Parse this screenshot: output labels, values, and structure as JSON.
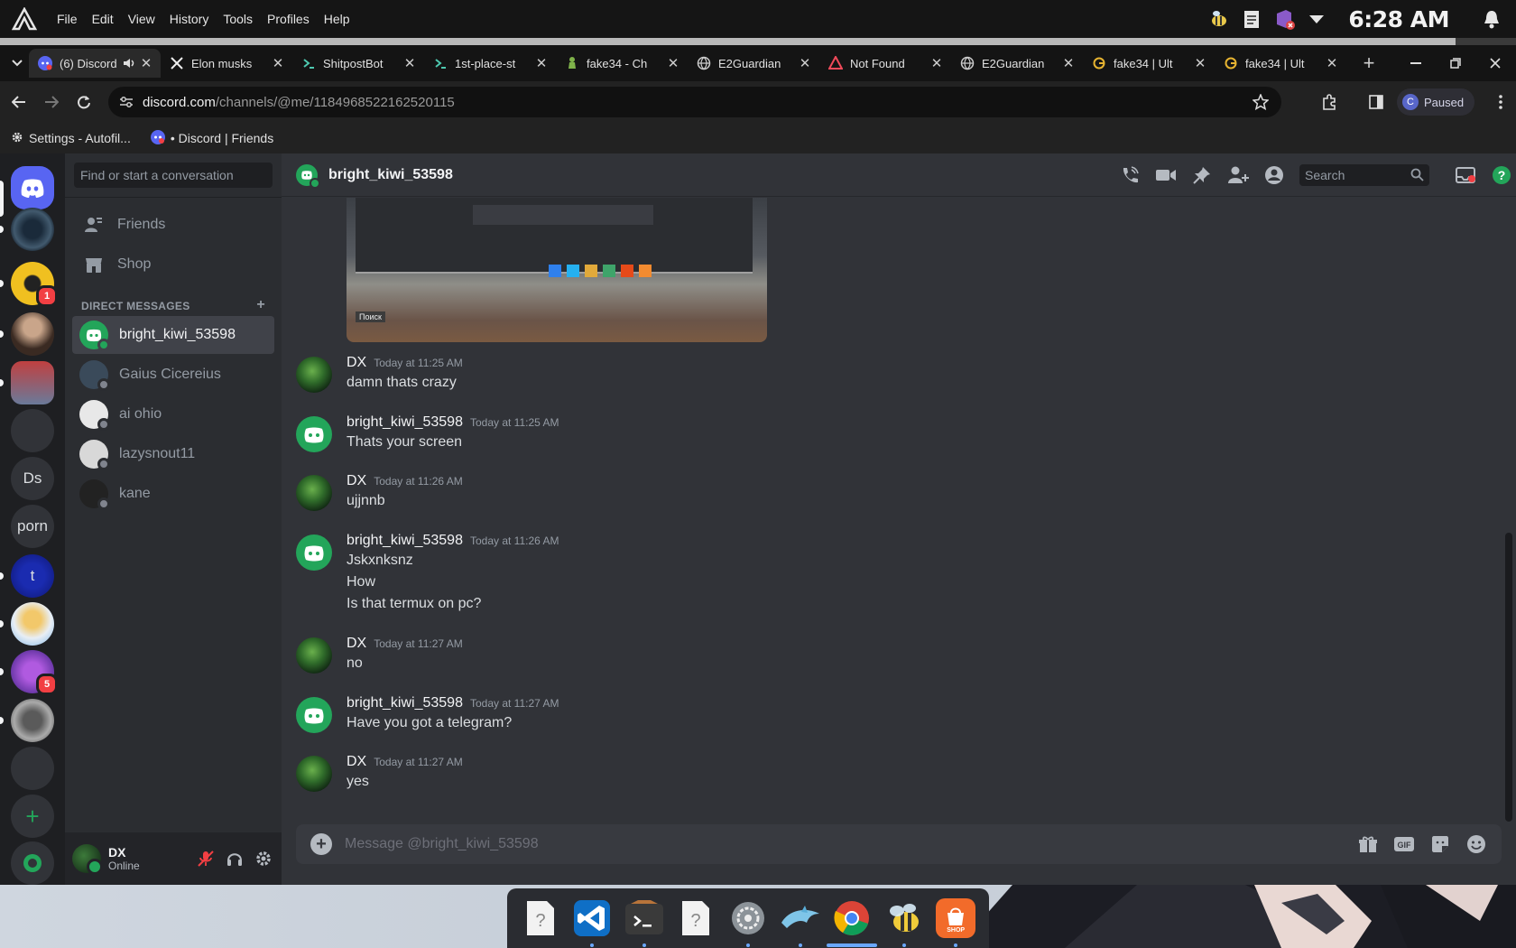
{
  "os": {
    "menus": [
      "File",
      "Edit",
      "View",
      "History",
      "Tools",
      "Profiles",
      "Help"
    ],
    "clock": "6:28 AM",
    "progress": 0.96
  },
  "browser": {
    "tabs": [
      {
        "label": "(6) Discord",
        "icon": "discord-icon"
      },
      {
        "label": "Elon musks",
        "icon": "x-icon"
      },
      {
        "label": "ShitpostBot",
        "icon": "terminal-icon"
      },
      {
        "label": "1st-place-st",
        "icon": "terminal-icon"
      },
      {
        "label": "fake34 - Ch",
        "icon": "chess-icon"
      },
      {
        "label": "E2Guardian",
        "icon": "globe-icon"
      },
      {
        "label": "Not Found",
        "icon": "warning-icon"
      },
      {
        "label": "E2Guardian",
        "icon": "globe-icon"
      },
      {
        "label": "fake34 | Ult",
        "icon": "g-icon"
      },
      {
        "label": "fake34 | Ult",
        "icon": "g-icon"
      }
    ],
    "url_host": "discord.com",
    "url_path": "/channels/@me/1184968522162520115",
    "profile_initial": "C",
    "profile_status": "Paused",
    "bookmarks": [
      {
        "label": "Settings - Autofil..."
      },
      {
        "label": "• Discord | Friends"
      }
    ]
  },
  "discord": {
    "guilds": [
      {
        "label": "",
        "badge": ""
      },
      {
        "label": "",
        "badge": "1"
      },
      {
        "label": "",
        "badge": ""
      },
      {
        "label": "",
        "badge": ""
      },
      {
        "label": "",
        "badge": ""
      },
      {
        "label": "Ds",
        "badge": ""
      },
      {
        "label": "porn",
        "badge": ""
      },
      {
        "label": "t",
        "badge": ""
      },
      {
        "label": "",
        "badge": ""
      },
      {
        "label": "",
        "badge": "5"
      },
      {
        "label": "",
        "badge": ""
      },
      {
        "label": "",
        "badge": ""
      }
    ],
    "search_placeholder": "Find or start a conversation",
    "nav": [
      {
        "label": "Friends"
      },
      {
        "label": "Shop"
      }
    ],
    "dm_header": "DIRECT MESSAGES",
    "dms": [
      {
        "name": "bright_kiwi_53598",
        "color": "#23a55a"
      },
      {
        "name": "Gaius Cicereius",
        "color": "#3a4a5a"
      },
      {
        "name": "ai ohio",
        "color": "#e8e8e8"
      },
      {
        "name": "lazysnout11",
        "color": "#d8d8d8"
      },
      {
        "name": "kane",
        "color": "#222222"
      }
    ],
    "user": {
      "name": "DX",
      "status": "Online"
    },
    "channel": {
      "title": "bright_kiwi_53598"
    },
    "header_search": "Search",
    "messages": [
      {
        "author": "DX",
        "time": "Today at 11:25 AM",
        "lines": [
          "damn thats crazy"
        ],
        "self": true
      },
      {
        "author": "bright_kiwi_53598",
        "time": "Today at 11:25 AM",
        "lines": [
          "Thats your screen"
        ],
        "self": false
      },
      {
        "author": "DX",
        "time": "Today at 11:26 AM",
        "lines": [
          "ujjnnb"
        ],
        "self": true
      },
      {
        "author": "bright_kiwi_53598",
        "time": "Today at 11:26 AM",
        "lines": [
          "Jskxnksnz",
          "How",
          "Is that termux on pc?"
        ],
        "self": false
      },
      {
        "author": "DX",
        "time": "Today at 11:27 AM",
        "lines": [
          "no"
        ],
        "self": true
      },
      {
        "author": "bright_kiwi_53598",
        "time": "Today at 11:27 AM",
        "lines": [
          "Have you got a telegram?"
        ],
        "self": false
      },
      {
        "author": "DX",
        "time": "Today at 11:27 AM",
        "lines": [
          "yes"
        ],
        "self": true
      }
    ],
    "preview_caption": "Поиск",
    "composer_placeholder": "Message @bright_kiwi_53598"
  },
  "dock": {
    "apps": [
      "unknown-file-icon",
      "vscode-icon",
      "terminal-icon",
      "unknown-file-icon",
      "settings-icon",
      "dolphin-icon",
      "chrome-icon",
      "bee-icon",
      "shop-icon"
    ],
    "shop_label": "SHOP"
  },
  "colors": {
    "blurple": "#5865f2",
    "green": "#23a55a",
    "red": "#f23f43"
  }
}
